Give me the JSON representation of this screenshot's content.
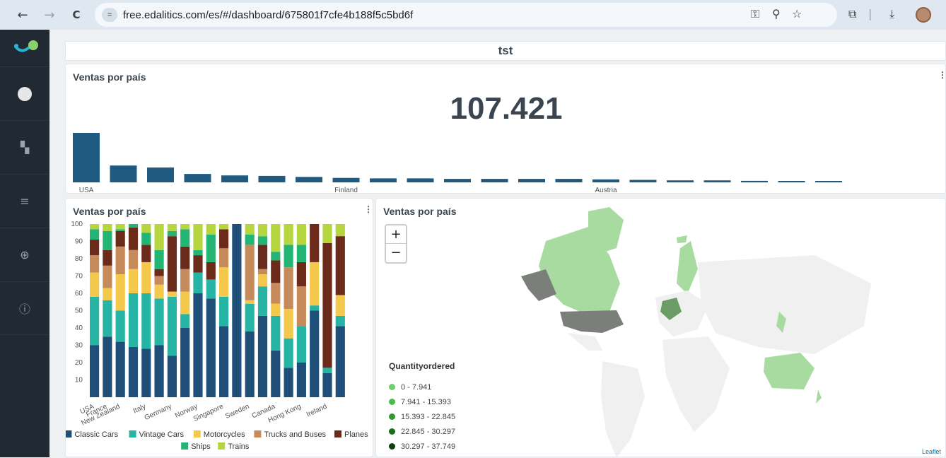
{
  "browser": {
    "url": "free.edalitics.com/es/#/dashboard/675801f7cfe4b188f5c5bd6f",
    "back_glyph": "←",
    "forward_glyph": "→",
    "reload_glyph": "C",
    "site_info_glyph": "≈",
    "key_glyph": "⚿",
    "zoom_glyph": "⚲",
    "star_glyph": "☆",
    "ext_glyph": "⧉",
    "download_glyph": "⤓"
  },
  "sidebar": {
    "items": [
      {
        "icon": "user-avatar-icon",
        "glyph": "●"
      },
      {
        "icon": "dashboard-icon",
        "glyph": "▚"
      },
      {
        "icon": "database-icon",
        "glyph": "≡"
      },
      {
        "icon": "globe-icon",
        "glyph": "⊕"
      },
      {
        "icon": "info-icon",
        "glyph": "ⓘ"
      }
    ]
  },
  "dashboard": {
    "title": "tst"
  },
  "panel_top": {
    "title": "Ventas por país",
    "menu": "⋮",
    "kpi_value": "107.421"
  },
  "panel_stacked": {
    "title": "Ventas por país",
    "menu": "⋮"
  },
  "panel_map": {
    "title": "Ventas por país",
    "menu": "⋮",
    "zoom_in": "+",
    "zoom_out": "−",
    "legend_title": "Quantityordered",
    "legend": [
      {
        "label": "0 - 7.941",
        "color": "#6fcf6f"
      },
      {
        "label": "7.941 - 15.393",
        "color": "#4dbb4d"
      },
      {
        "label": "15.393 - 22.845",
        "color": "#2e9a2e"
      },
      {
        "label": "22.845 - 30.297",
        "color": "#1b6e1b"
      },
      {
        "label": "30.297 - 37.749",
        "color": "#0e3d0e"
      }
    ],
    "attribution": "Leaflet"
  },
  "chart_data": [
    {
      "type": "bar",
      "color": "#1f5a80",
      "categories": [
        "USA",
        "",
        "",
        "",
        "",
        "",
        "",
        "Finland",
        "",
        "",
        "",
        "",
        "",
        "",
        "Austria",
        "",
        "",
        "",
        "",
        "",
        ""
      ],
      "values": [
        100,
        34,
        30,
        17,
        14,
        13,
        11,
        9,
        8,
        8,
        7,
        7,
        7,
        7,
        6,
        5,
        4,
        4,
        3,
        2,
        1
      ],
      "tick_labels": [
        "USA",
        "Finland",
        "Austria"
      ]
    },
    {
      "type": "bar",
      "stacked": true,
      "percent": true,
      "ylim": [
        0,
        100
      ],
      "yticks": [
        10,
        20,
        30,
        40,
        50,
        60,
        70,
        80,
        90,
        100
      ],
      "categories": [
        "USA",
        "France",
        "New Zealand",
        "",
        "Italy",
        "",
        "Germany",
        "",
        "Norway",
        "",
        "Singapore",
        "",
        "Sweden",
        "",
        "Canada",
        "",
        "Hong Kong",
        "",
        "Ireland"
      ],
      "category_labels_shown": [
        "USA",
        "France",
        "New Zealand",
        "Italy",
        "Germany",
        "Norway",
        "Singapore",
        "Sweden",
        "Canada",
        "Hong Kong",
        "Ireland"
      ],
      "series": [
        {
          "name": "Classic Cars",
          "color": "#1f4e79",
          "values": [
            30,
            35,
            32,
            29,
            28,
            30,
            24,
            40,
            60,
            57,
            41,
            100,
            38,
            47,
            27,
            17,
            20,
            50,
            14,
            41
          ]
        },
        {
          "name": "Vintage Cars",
          "color": "#26b5a5",
          "values": [
            28,
            21,
            18,
            31,
            32,
            27,
            34,
            8,
            12,
            11,
            17,
            0,
            16,
            17,
            20,
            17,
            21,
            3,
            3,
            6
          ]
        },
        {
          "name": "Motorcycles",
          "color": "#f4c84a",
          "values": [
            14,
            7,
            21,
            14,
            18,
            8,
            3,
            13,
            0,
            0,
            17,
            0,
            2,
            7,
            7,
            17,
            0,
            25,
            0,
            12
          ]
        },
        {
          "name": "Trucks and Buses",
          "color": "#c78a5a",
          "values": [
            10,
            13,
            16,
            11,
            0,
            5,
            0,
            13,
            0,
            0,
            11,
            0,
            32,
            3,
            12,
            24,
            23,
            0,
            0,
            0
          ]
        },
        {
          "name": "Planes",
          "color": "#6b2a1a",
          "values": [
            9,
            9,
            9,
            13,
            10,
            4,
            32,
            13,
            10,
            10,
            11,
            0,
            0,
            14,
            13,
            0,
            14,
            22,
            72,
            34
          ]
        },
        {
          "name": "Ships",
          "color": "#22b573",
          "values": [
            6,
            11,
            1,
            2,
            7,
            11,
            3,
            10,
            3,
            16,
            0,
            0,
            6,
            5,
            5,
            13,
            10,
            0,
            0,
            0
          ]
        },
        {
          "name": "Trains",
          "color": "#b5d63f",
          "values": [
            3,
            4,
            3,
            0,
            5,
            15,
            4,
            3,
            15,
            6,
            3,
            0,
            6,
            7,
            16,
            12,
            12,
            0,
            11,
            7
          ]
        }
      ]
    }
  ]
}
